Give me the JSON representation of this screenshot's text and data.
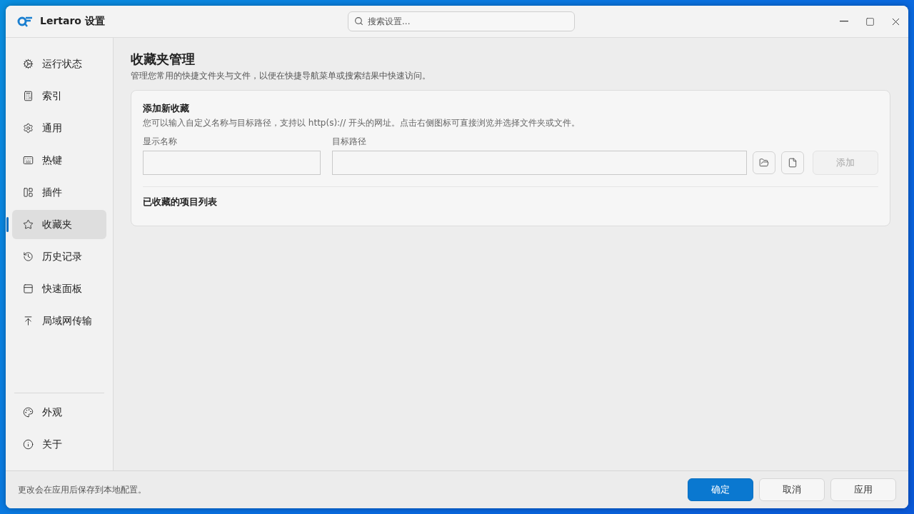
{
  "window": {
    "title": "Lertaro 设置"
  },
  "search": {
    "placeholder": "搜索设置..."
  },
  "sidebar": {
    "items": [
      {
        "label": "运行状态",
        "selected": false
      },
      {
        "label": "索引",
        "selected": false
      },
      {
        "label": "通用",
        "selected": false
      },
      {
        "label": "热键",
        "selected": false
      },
      {
        "label": "插件",
        "selected": false
      },
      {
        "label": "收藏夹",
        "selected": true
      },
      {
        "label": "历史记录",
        "selected": false
      },
      {
        "label": "快速面板",
        "selected": false
      },
      {
        "label": "局域网传输",
        "selected": false
      }
    ],
    "bottom_items": [
      {
        "label": "外观",
        "selected": false
      },
      {
        "label": "关于",
        "selected": false
      }
    ]
  },
  "page": {
    "title": "收藏夹管理",
    "description": "管理您常用的快捷文件夹与文件，以便在快捷导航菜单或搜索结果中快速访问。",
    "card": {
      "title": "添加新收藏",
      "description": "您可以输入自定义名称与目标路径，支持以 http(s):// 开头的网址。点击右侧图标可直接浏览并选择文件夹或文件。",
      "name_label": "显示名称",
      "path_label": "目标路径",
      "add_button": {
        "label": "添加",
        "disabled": true
      },
      "list_title": "已收藏的项目列表"
    }
  },
  "status_bar": {
    "text": "更改会在应用后保存到本地配置。"
  },
  "buttons": [
    {
      "label": "确定",
      "kind": "primary"
    },
    {
      "label": "取消",
      "kind": "secondary"
    },
    {
      "label": "应用",
      "kind": "secondary"
    }
  ]
}
